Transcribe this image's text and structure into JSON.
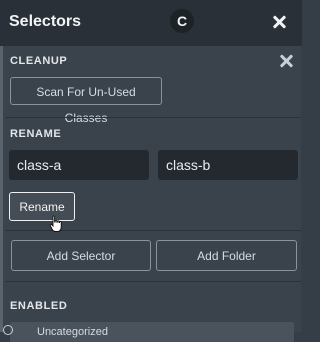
{
  "header": {
    "title": "Selectors",
    "badge": "C"
  },
  "cleanup": {
    "label": "CLEANUP",
    "scan_button": "Scan For Un-Used Classes"
  },
  "rename": {
    "label": "RENAME",
    "from_value": "class-a",
    "to_value": "class-b",
    "rename_button": "Rename"
  },
  "actions": {
    "add_selector": "Add Selector",
    "add_folder": "Add Folder"
  },
  "enabled": {
    "label": "ENABLED",
    "items": [
      {
        "label": "Uncategorized"
      }
    ]
  }
}
